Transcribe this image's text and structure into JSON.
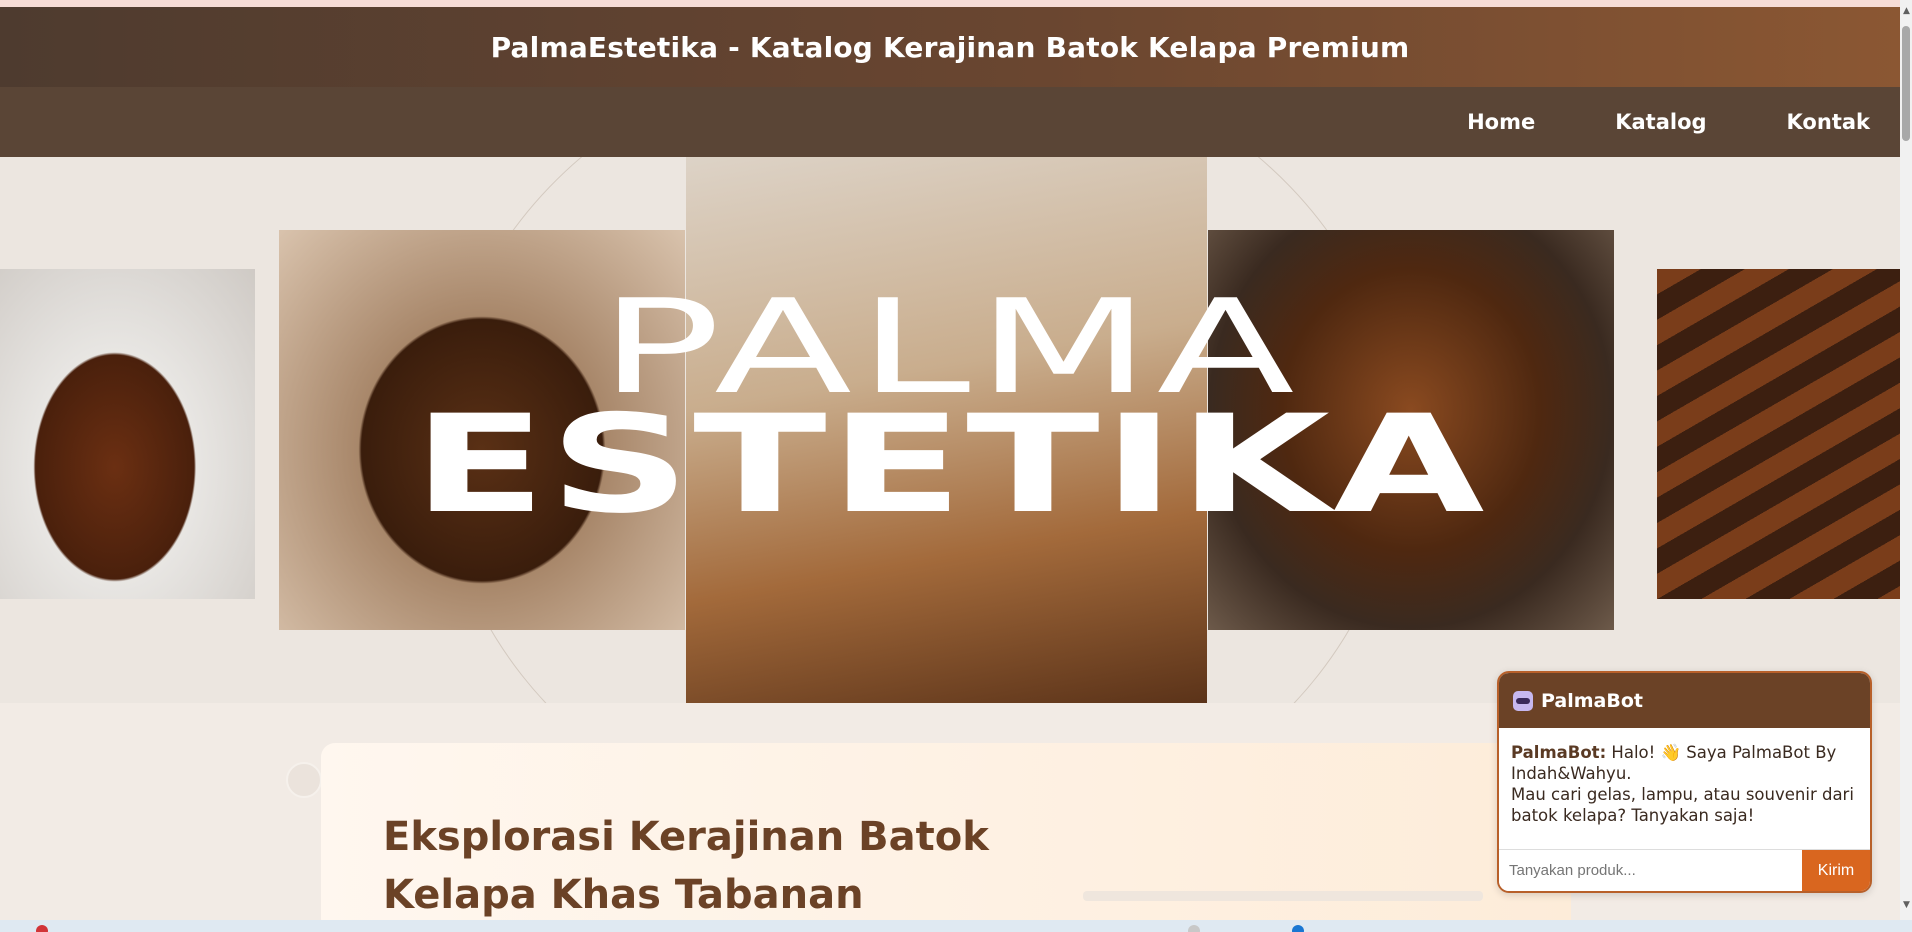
{
  "site": {
    "title": "PalmaEstetika - Katalog Kerajinan Batok Kelapa Premium"
  },
  "nav": {
    "items": [
      {
        "label": "Home"
      },
      {
        "label": "Katalog"
      },
      {
        "label": "Kontak"
      }
    ]
  },
  "hero": {
    "line1": "PALMA",
    "line2": "ESTETIKA",
    "images": [
      {
        "name": "coconut-shell-box"
      },
      {
        "name": "coconut-shell-glass"
      },
      {
        "name": "carved-bird-sculpture"
      },
      {
        "name": "coconut-shell-bowl"
      },
      {
        "name": "coconut-shell-spoons"
      }
    ]
  },
  "feature": {
    "heading": "Eksplorasi Kerajinan Batok Kelapa Khas Tabanan"
  },
  "chat": {
    "title": "PalmaBot",
    "sender": "PalmaBot:",
    "message1": "Halo! 👋 Saya PalmaBot By Indah&Wahyu.",
    "message2": "Mau cari gelas, lampu, atau souvenir dari batok kelapa? Tanyakan saja!",
    "input_placeholder": "Tanyakan produk...",
    "send_label": "Kirim"
  },
  "colors": {
    "header_start": "#4e3b2f",
    "header_end": "#8b5733",
    "nav_bg": "#5a4536",
    "heading": "#6b4226",
    "chat_accent": "#d9661f"
  }
}
